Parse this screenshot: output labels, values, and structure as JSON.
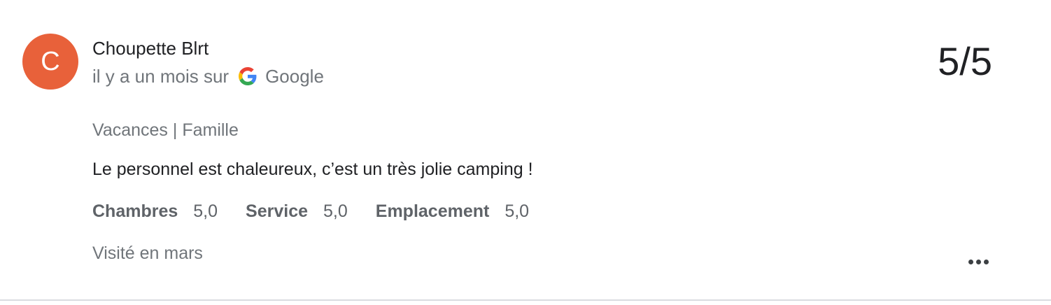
{
  "review": {
    "avatar_initial": "C",
    "avatar_color": "#e8613a",
    "author": "Choupette Blrt",
    "time_ago": "il y a un mois sur",
    "source_icon": "google-g-icon",
    "source": "Google",
    "score": "5/5",
    "trip_type": "Vacances | Famille",
    "text": "Le personnel est chaleureux, c’est un très jolie camping !",
    "ratings": [
      {
        "label": "Chambres",
        "value": "5,0"
      },
      {
        "label": "Service",
        "value": "5,0"
      },
      {
        "label": "Emplacement",
        "value": "5,0"
      }
    ],
    "visited": "Visité en mars",
    "more_icon": "more-horizontal-icon"
  }
}
